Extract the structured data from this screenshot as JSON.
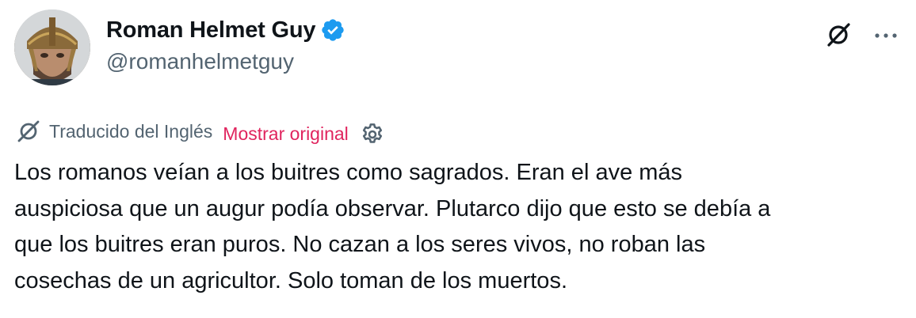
{
  "author": {
    "display_name": "Roman Helmet Guy",
    "handle": "@romanhelmetguy",
    "verified": true,
    "avatar_icon": "avatar-photo"
  },
  "actions": {
    "grok_icon": "grok-icon",
    "more_icon": "more-horizontal-icon"
  },
  "translation": {
    "icon": "translate-icon",
    "label": "Traducido del Inglés",
    "show_original": "Mostrar original",
    "settings_icon": "gear-icon"
  },
  "tweet": {
    "lines": [
      "Los romanos veían a los buitres como sagrados. Eran el ave más",
      "auspiciosa que un augur podía observar. Plutarco dijo que esto se debía a",
      "que los buitres eran puros. No cazan a los seres vivos, no roban las",
      "cosechas de un agricultor. Solo toman de los muertos."
    ]
  },
  "colors": {
    "text_primary": "#0f1419",
    "text_secondary": "#536471",
    "link_pink": "#e0245e",
    "verified_blue": "#1d9bf0"
  }
}
